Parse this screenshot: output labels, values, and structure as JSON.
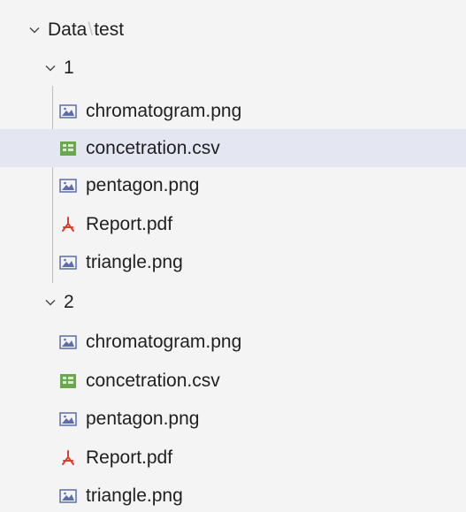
{
  "explorer": {
    "root": {
      "prefix": "Data",
      "separator": "\\",
      "suffix": "test"
    },
    "groups": [
      {
        "label": "1",
        "files": [
          {
            "name": "chromatogram.png",
            "icon": "image-icon"
          },
          {
            "name": "concetration.csv",
            "icon": "csv-icon"
          },
          {
            "name": "pentagon.png",
            "icon": "image-icon"
          },
          {
            "name": "Report.pdf",
            "icon": "pdf-icon"
          },
          {
            "name": "triangle.png",
            "icon": "image-icon"
          }
        ]
      },
      {
        "label": "2",
        "files": [
          {
            "name": "chromatogram.png",
            "icon": "image-icon"
          },
          {
            "name": "concetration.csv",
            "icon": "csv-icon"
          },
          {
            "name": "pentagon.png",
            "icon": "image-icon"
          },
          {
            "name": "Report.pdf",
            "icon": "pdf-icon"
          },
          {
            "name": "triangle.png",
            "icon": "image-icon"
          }
        ]
      }
    ],
    "selected_item": "concetration.csv",
    "colors": {
      "background": "#f4f4f4",
      "selection": "#e4e6f1",
      "text": "#1f1f1f",
      "image_icon": "#5b6ea8",
      "csv_icon": "#6aa84f",
      "pdf_icon": "#d9412f"
    }
  }
}
